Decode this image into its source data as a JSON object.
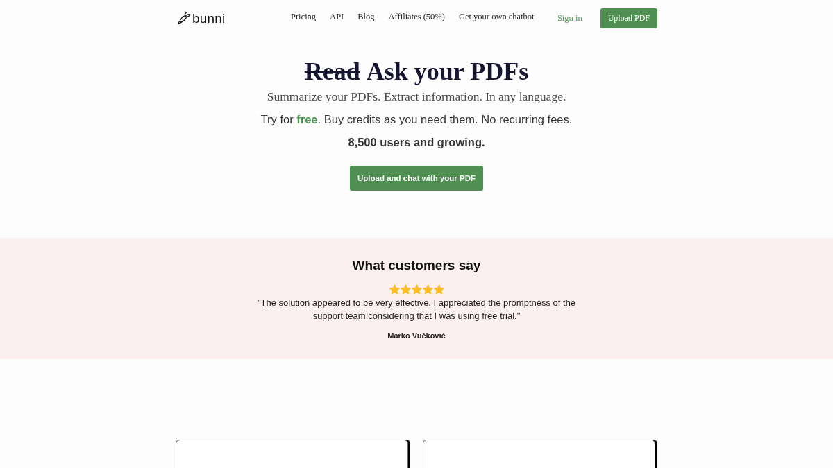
{
  "nav": {
    "logo": "bunni",
    "links": [
      "Pricing",
      "API",
      "Blog",
      "Affiliates (50%)",
      "Get your own chatbot"
    ],
    "sign_in": "Sign in",
    "cta": "Upload PDF"
  },
  "hero": {
    "struck_word": "Read",
    "title": "Ask your PDFs",
    "subtitle": "Summarize your PDFs. Extract information. In any language.",
    "pitch": "Try for **free**. Buy credits as you need them. No recurring fees.",
    "users": "8,500 users and growing.",
    "button": "Upload and chat with your PDF"
  },
  "testimonials": {
    "heading": "What customers say",
    "stars": 5,
    "quote": "\"The solution appeared to be very effective. I appreciated the promptness of the support team considering that I was using free trial.\"",
    "author": "Marko Vučković"
  }
}
